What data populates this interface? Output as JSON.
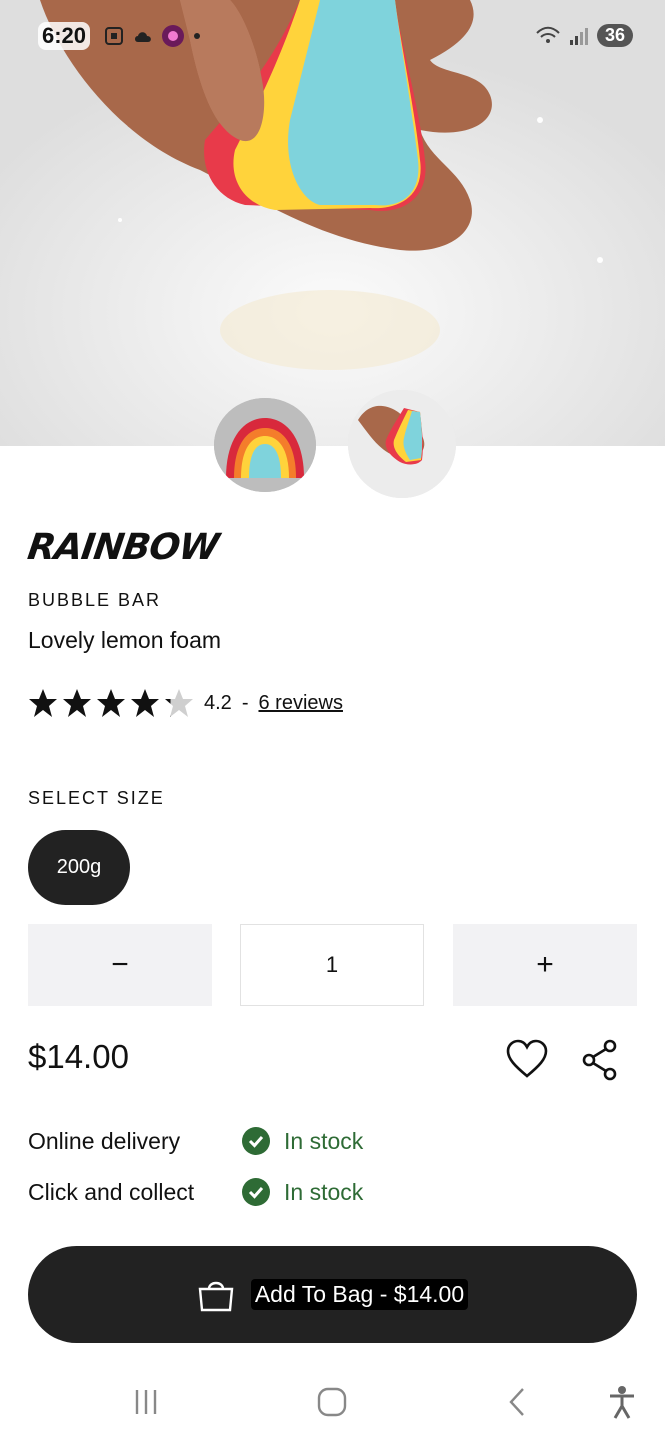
{
  "status_bar": {
    "time": "6:20",
    "battery": "36"
  },
  "product": {
    "title": "RAINBOW",
    "category": "BUBBLE BAR",
    "tagline": "Lovely lemon foam",
    "rating_value": 4.2,
    "rating_text": "4.2",
    "rating_separator": "-",
    "reviews_link": "6 reviews",
    "select_size_label": "SELECT SIZE",
    "size_option": "200g",
    "quantity": "1",
    "quantity_minus": "−",
    "quantity_plus": "+",
    "price": "$14.00"
  },
  "availability": [
    {
      "label": "Online delivery",
      "status": "In stock"
    },
    {
      "label": "Click and collect",
      "status": "In stock"
    }
  ],
  "add_to_bag": {
    "label": "Add To Bag - $14.00"
  },
  "colors": {
    "dark": "#222222",
    "in_stock_green": "#2e6b35",
    "qty_bg": "#f2f2f4"
  },
  "icons": [
    "heart-icon",
    "share-icon",
    "check-circle-icon",
    "shopping-bag-icon",
    "recent-apps-icon",
    "home-icon",
    "back-icon",
    "accessibility-icon"
  ]
}
